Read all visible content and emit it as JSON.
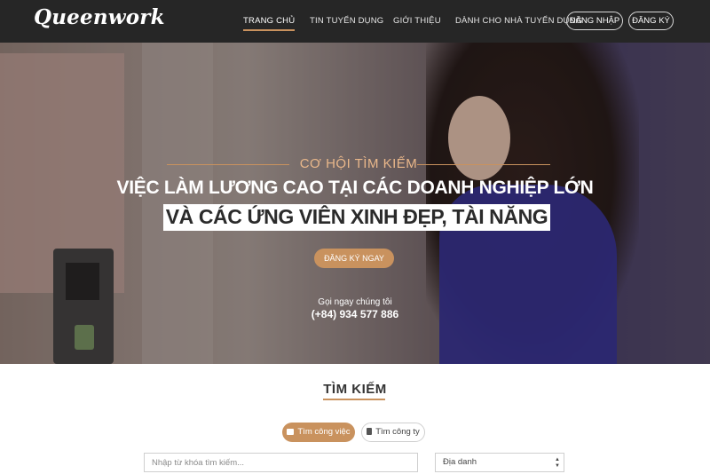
{
  "header": {
    "logo": "Queenwork",
    "nav": [
      {
        "label": "TRANG CHỦ",
        "active": true
      },
      {
        "label": "TIN TUYỂN DỤNG",
        "active": false
      },
      {
        "label": "GIỚI THIỆU",
        "active": false
      },
      {
        "label": "DÀNH CHO NHÀ TUYỂN DỤNG",
        "active": false
      }
    ],
    "login_label": "ĐĂNG NHẬP",
    "register_label": "ĐĂNG KÝ"
  },
  "hero": {
    "subtitle": "CƠ HỘI TÌM KIẾM",
    "title_line1": "VIỆC LÀM LƯƠNG CAO TẠI CÁC DOANH NGHIỆP LỚN",
    "title_line2": "VÀ CÁC ỨNG VIÊN XINH ĐẸP, TÀI NĂNG",
    "cta_label": "ĐĂNG KÝ NGAY",
    "call_label": "Gọi ngay chúng tôi",
    "phone": "(+84) 934 577 886"
  },
  "search": {
    "title": "TÌM KIẾM",
    "tabs": [
      {
        "label": "Tìm công việc",
        "icon": "briefcase-icon",
        "active": true
      },
      {
        "label": "Tìm công ty",
        "icon": "building-icon",
        "active": false
      }
    ],
    "keyword_placeholder": "Nhập từ khóa tìm kiếm...",
    "location_value": "Địa danh"
  },
  "colors": {
    "accent": "#c9925e",
    "navbar_bg": "#262626"
  }
}
